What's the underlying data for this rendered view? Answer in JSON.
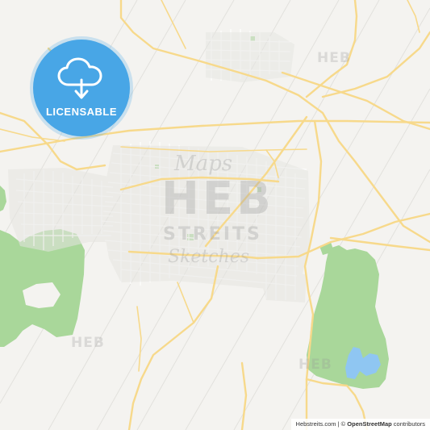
{
  "badge": {
    "label": "LICENSABLE",
    "icon": "cloud-download-icon",
    "color": "#48a6e6"
  },
  "watermarks": {
    "small": "HEB",
    "logo_top": "Maps",
    "logo_main": "HEB",
    "logo_mid": "STREITS",
    "logo_bottom": "Sketches"
  },
  "attribution": {
    "site": "Hebstreits.com",
    "separator": " | © ",
    "osm": "OpenStreetMap",
    "suffix": " contributors"
  },
  "colors": {
    "background": "#f4f3f0",
    "road_major": "#f7d98b",
    "road_minor": "#ffffff",
    "park": "#a9d79a",
    "water": "#8fc6f2"
  }
}
